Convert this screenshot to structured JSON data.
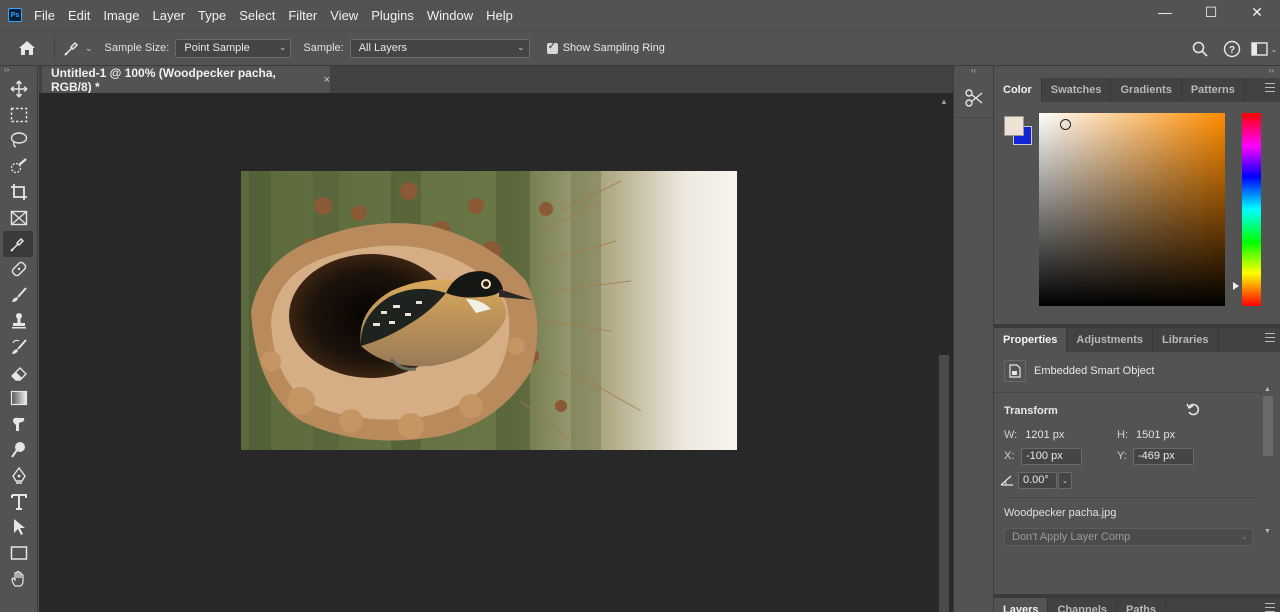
{
  "app": {
    "logo_text": "Ps"
  },
  "menu": [
    "File",
    "Edit",
    "Image",
    "Layer",
    "Type",
    "Select",
    "Filter",
    "View",
    "Plugins",
    "Window",
    "Help"
  ],
  "window_controls": {
    "minimize": "—",
    "maximize": "☐",
    "close": "✕"
  },
  "options": {
    "sample_size_label": "Sample Size:",
    "sample_size_value": "Point Sample",
    "sample_label": "Sample:",
    "sample_value": "All Layers",
    "sampling_ring_label": "Show Sampling Ring",
    "sampling_ring_checked": true
  },
  "document": {
    "tab_title": "Untitled-1 @ 100% (Woodpecker pacha, RGB/8) *",
    "tab_close": "×"
  },
  "tools": [
    "move",
    "marquee",
    "lasso",
    "quick-select",
    "crop",
    "frame",
    "eyedropper",
    "spot-healing",
    "brush",
    "clone-stamp",
    "history-brush",
    "eraser",
    "gradient",
    "smudge",
    "dodge",
    "pen",
    "type",
    "path-select",
    "rectangle",
    "hand"
  ],
  "color_panel": {
    "tabs": [
      "Color",
      "Swatches",
      "Gradients",
      "Patterns"
    ],
    "active_tab": "Color",
    "foreground": "#ede2d4",
    "background": "#1326d6"
  },
  "properties_panel": {
    "tabs": [
      "Properties",
      "Adjustments",
      "Libraries"
    ],
    "active_tab": "Properties",
    "object_type": "Embedded Smart Object",
    "transform_title": "Transform",
    "w_label": "W:",
    "w_value": "1201 px",
    "h_label": "H:",
    "h_value": "1501 px",
    "x_label": "X:",
    "x_value": "-100 px",
    "y_label": "Y:",
    "y_value": "-469 px",
    "angle_value": "0.00°",
    "filename": "Woodpecker pacha.jpg",
    "layer_comp": "Don't Apply Layer Comp"
  },
  "layers_panel": {
    "tabs": [
      "Layers",
      "Channels",
      "Paths"
    ],
    "active_tab": "Layers"
  }
}
